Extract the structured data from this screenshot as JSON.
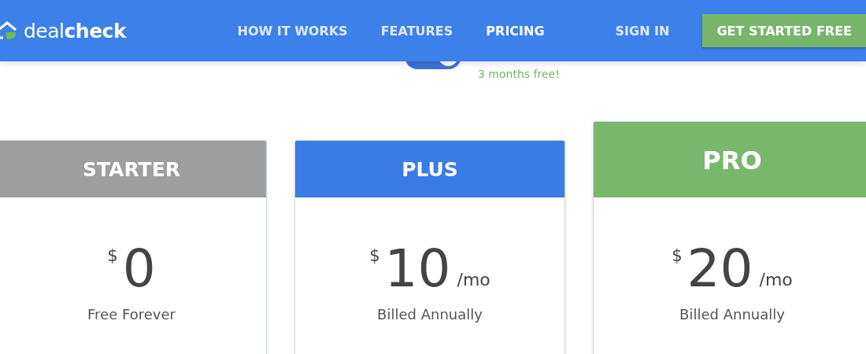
{
  "header": {
    "logo": "deal**check**",
    "nav": [
      {
        "label": "HOW IT WORKS",
        "selected": false
      },
      {
        "label": "FEATURES",
        "selected": false
      },
      {
        "label": "PRICING",
        "selected": true
      },
      {
        "label": "SIGN IN",
        "selected": false
      }
    ],
    "cta": "GET STARTED FREE"
  },
  "billing": {
    "on": true,
    "note": "3 months free!"
  },
  "plans": [
    {
      "name": "STARTER",
      "color": "#9e9e9e",
      "featured": false,
      "currency": "$",
      "price": "0",
      "caption": "Free Forever"
    },
    {
      "name": "PLUS",
      "color": "#3a7be6",
      "featured": false,
      "currency": "$",
      "price": "10",
      "period": "/mo",
      "caption": "Billed Annually"
    },
    {
      "name": "PRO",
      "color": "#78b86c",
      "featured": true,
      "currency": "$",
      "price": "20",
      "period": "/mo",
      "caption": "Billed Annually"
    }
  ]
}
